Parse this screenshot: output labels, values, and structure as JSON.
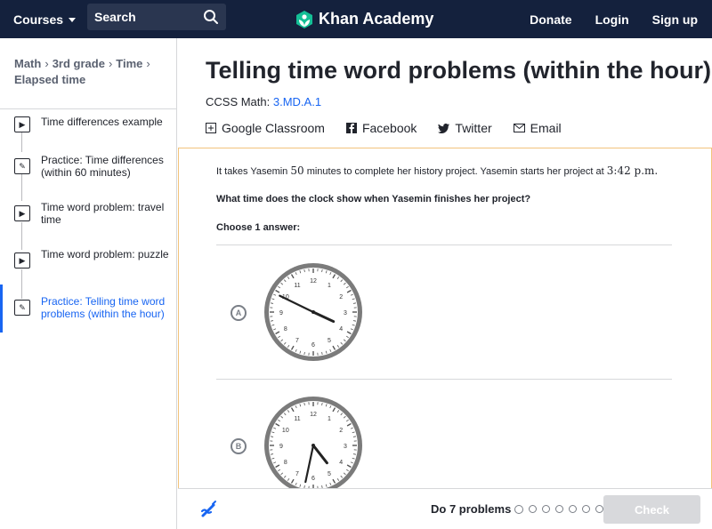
{
  "nav": {
    "courses": "Courses",
    "search_label": "Search",
    "logo_text": "Khan Academy",
    "donate": "Donate",
    "login": "Login",
    "signup": "Sign up"
  },
  "sidebar": {
    "breadcrumb": [
      "Math",
      "3rd grade",
      "Time",
      "Elapsed time"
    ],
    "items": [
      {
        "label": "Time differences example",
        "icon": "play-icon",
        "active": false
      },
      {
        "label": "Practice: Time differences (within 60 minutes)",
        "icon": "pencil-icon",
        "active": false
      },
      {
        "label": "Time word problem: travel time",
        "icon": "play-icon",
        "active": false
      },
      {
        "label": "Time word problem: puzzle",
        "icon": "play-icon",
        "active": false
      },
      {
        "label": "Practice: Telling time word problems (within the hour)",
        "icon": "pencil-icon",
        "active": true
      }
    ]
  },
  "main": {
    "title": "Telling time word problems (within the hour)",
    "ccss_label": "CCSS Math:",
    "ccss_code": "3.MD.A.1",
    "share": {
      "google": "Google Classroom",
      "facebook": "Facebook",
      "twitter": "Twitter",
      "email": "Email"
    }
  },
  "exercise": {
    "q_part1": "It takes Yasemin ",
    "q_minutes": "50",
    "q_part2": " minutes to complete her history project. Yasemin starts her project at ",
    "q_time": "3:42 p.m.",
    "q_part3": "",
    "question": "What time does the clock show when Yasemin finishes her project?",
    "instruction": "Choose 1 answer:",
    "choices": [
      {
        "letter": "A",
        "hour_angle_deg": 115,
        "minute_angle_deg": 296
      },
      {
        "letter": "B",
        "hour_angle_deg": 142,
        "minute_angle_deg": 192
      }
    ]
  },
  "footer": {
    "progress": "Do 7 problems",
    "dot_count": 7,
    "check": "Check"
  },
  "colors": {
    "navbar": "#14213d",
    "link": "#1865f2",
    "panel_border": "#f2c37c",
    "check_disabled": "#d8d9dc"
  }
}
